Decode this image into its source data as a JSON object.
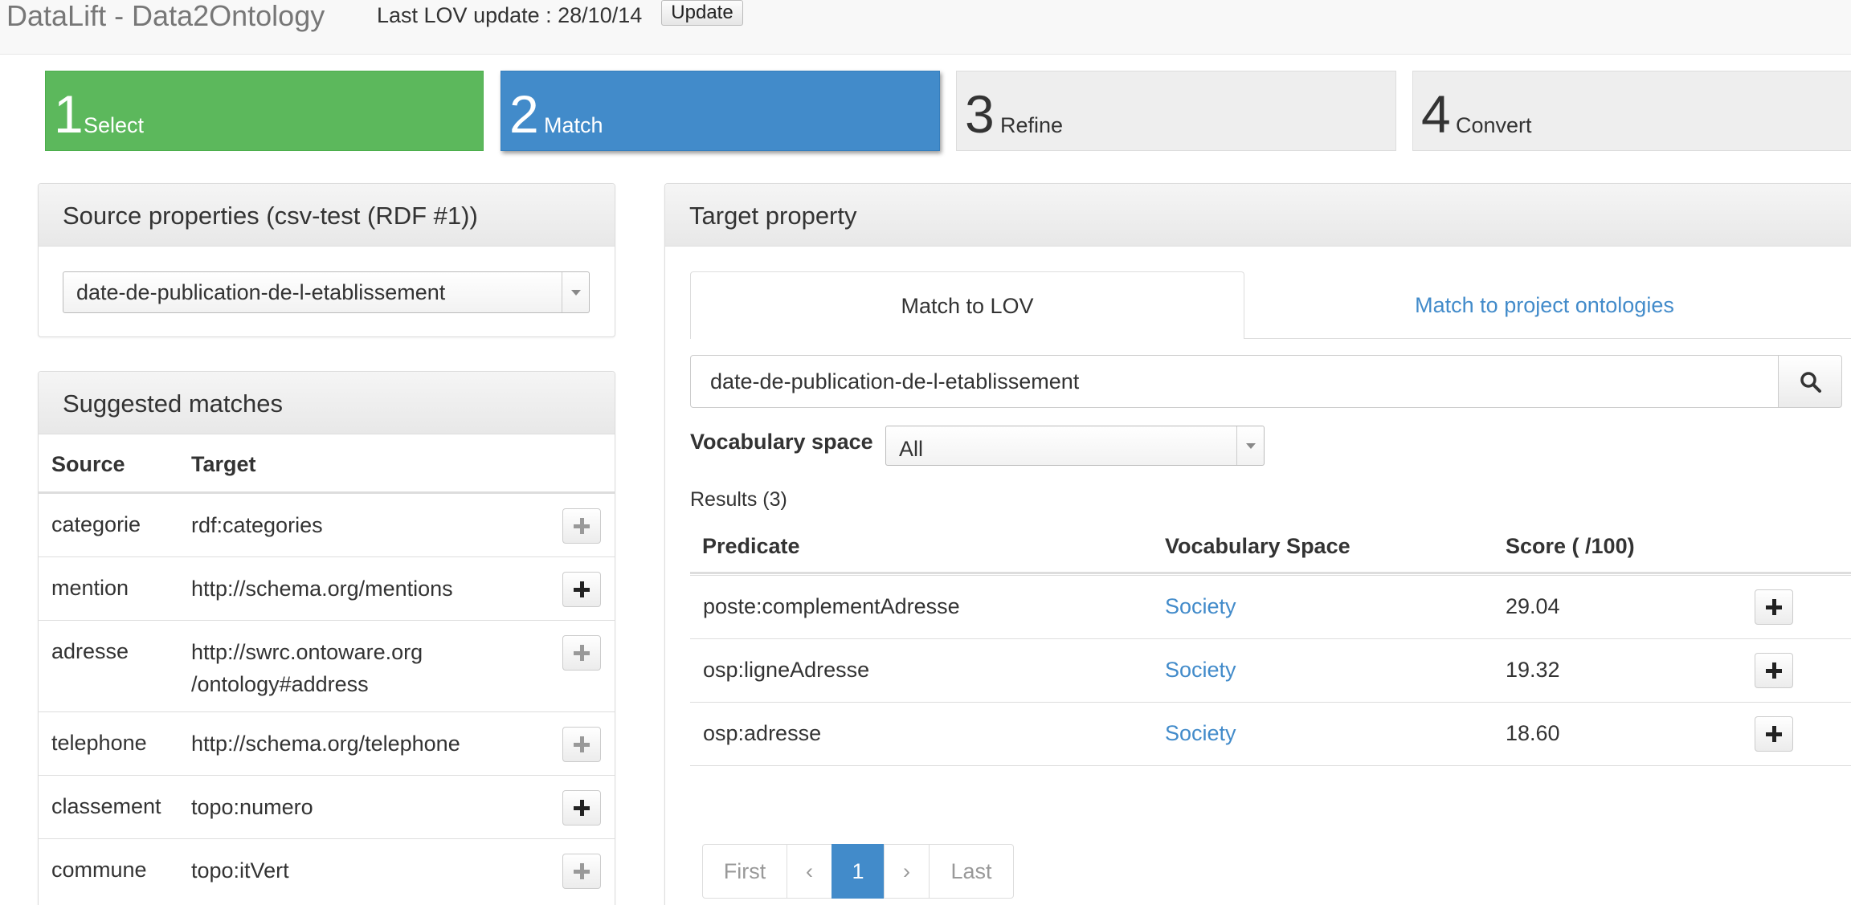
{
  "header": {
    "app_title": "DataLift - Data2Ontology",
    "lov_update_label": "Last LOV update : 28/10/14",
    "update_button": "Update"
  },
  "steps": [
    {
      "number": "1",
      "label": "Select",
      "color": "#5cb85c"
    },
    {
      "number": "2",
      "label": "Match",
      "color": "#428bca"
    },
    {
      "number": "3",
      "label": "Refine",
      "color": "#eeeeee"
    },
    {
      "number": "4",
      "label": "Convert",
      "color": "#eeeeee"
    }
  ],
  "source_panel": {
    "title": "Source properties (csv-test (RDF #1))",
    "selected_property": "date-de-publication-de-l-etablissement"
  },
  "suggested_panel": {
    "title": "Suggested matches",
    "columns": [
      "Source",
      "Target"
    ],
    "rows": [
      {
        "source": "categorie",
        "target": "rdf:categories",
        "button_state": "disabled"
      },
      {
        "source": "mention",
        "target": "http://schema.org/mentions",
        "button_state": "enabled"
      },
      {
        "source": "adresse",
        "target_line1": "http://swrc.ontoware.org",
        "target_line2": "/ontology#address",
        "button_state": "disabled"
      },
      {
        "source": "telephone",
        "target": "http://schema.org/telephone",
        "button_state": "disabled"
      },
      {
        "source": "classement",
        "target": "topo:numero",
        "button_state": "enabled"
      },
      {
        "source": "commune",
        "target": "topo:itVert",
        "button_state": "disabled"
      }
    ]
  },
  "target_panel": {
    "title": "Target property",
    "tabs": [
      {
        "label": "Match to LOV",
        "active": true
      },
      {
        "label": "Match to project ontologies",
        "active": false
      }
    ],
    "search_value": "date-de-publication-de-l-etablissement",
    "search_icon": "search-icon",
    "vocab_label": "Vocabulary space",
    "vocab_selected": "All",
    "results_label": "Results (3)",
    "columns": [
      "Predicate",
      "Vocabulary Space",
      "Score ( /100)"
    ],
    "results": [
      {
        "predicate": "poste:complementAdresse",
        "space": "Society",
        "score": "29.04"
      },
      {
        "predicate": "osp:ligneAdresse",
        "space": "Society",
        "score": "19.32"
      },
      {
        "predicate": "osp:adresse",
        "space": "Society",
        "score": "18.60"
      }
    ],
    "pagination": {
      "first": "First",
      "prev": "‹",
      "current": "1",
      "next": "›",
      "last": "Last"
    }
  }
}
